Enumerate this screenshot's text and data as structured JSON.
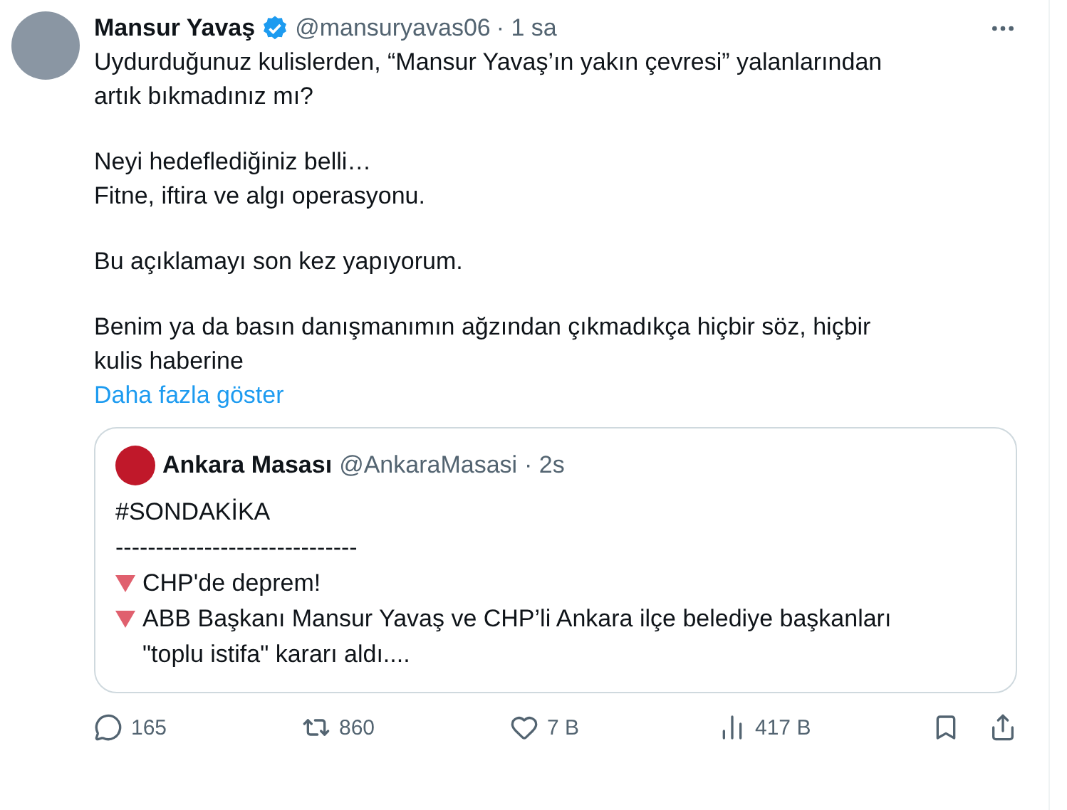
{
  "tweet": {
    "author": "Mansur Yavaş",
    "verified": true,
    "handle": "@mansuryavas06",
    "time": "· 1 sa",
    "paragraphs": [
      [
        "Uydurduğunuz kulislerden, “Mansur Yavaş’ın yakın çevresi” yalanlarından artık bıkmadınız mı?"
      ],
      [
        "Neyi hedeflediğiniz belli…",
        "Fitne, iftira ve algı operasyonu."
      ],
      [
        "Bu açıklamayı son kez yapıyorum."
      ],
      [
        "Benim ya da basın danışmanımın ağzından çıkmadıkça hiçbir söz, hiçbir kulis haberine"
      ]
    ],
    "show_more": "Daha fazla göster",
    "quote": {
      "author": "Ankara Masası",
      "handle": "@AnkaraMasasi",
      "time": "· 2s",
      "lines": [
        {
          "kind": "plain",
          "text": "#SONDAKİKA"
        },
        {
          "kind": "plain",
          "text": "------------------------------"
        },
        {
          "kind": "bullet",
          "text": "CHP'de deprem!"
        },
        {
          "kind": "bullet",
          "text": "ABB Başkanı Mansur Yavaş ve CHP’li Ankara ilçe belediye başkanları \"toplu istifa\" kararı aldı...."
        }
      ]
    },
    "stats": [
      {
        "kind": "reply",
        "count": "165"
      },
      {
        "kind": "repost",
        "count": "860"
      },
      {
        "kind": "like",
        "count": "7 B"
      },
      {
        "kind": "views",
        "count": "417 B"
      }
    ]
  }
}
